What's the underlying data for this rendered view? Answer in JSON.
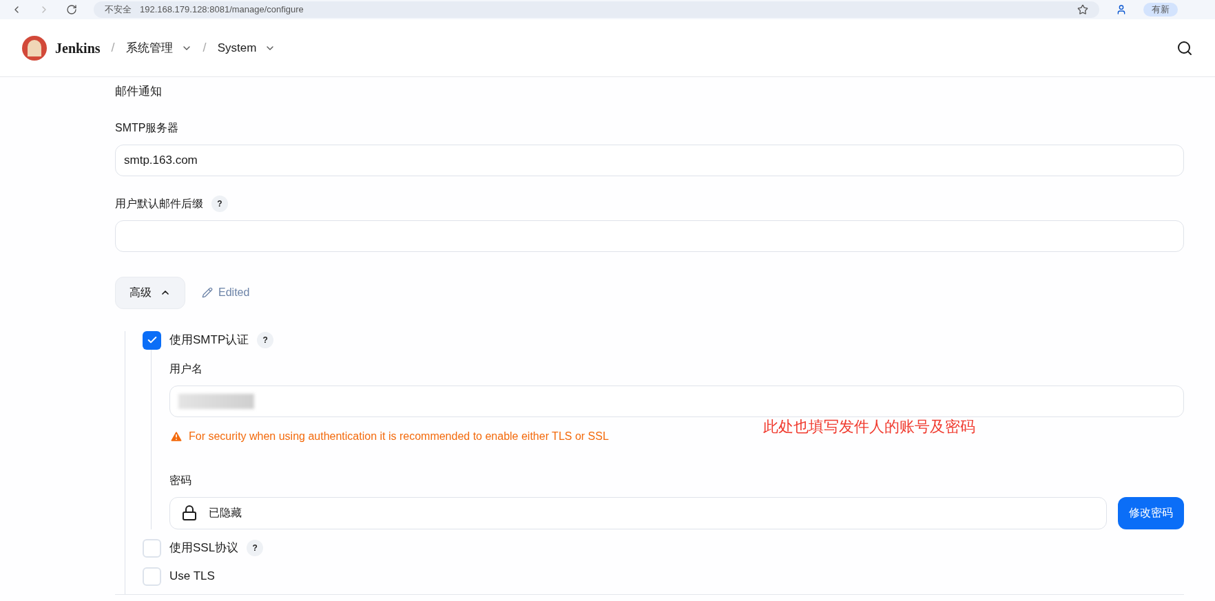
{
  "browser": {
    "security": "不安全",
    "url": "192.168.179.128:8081/manage/configure",
    "update_button": "有新"
  },
  "header": {
    "brand": "Jenkins",
    "breadcrumbs": [
      {
        "separator": "/",
        "label": "系统管理"
      },
      {
        "separator": "/",
        "label": "System"
      }
    ]
  },
  "section": {
    "title": "邮件通知"
  },
  "fields": [
    {
      "label": "SMTP服务器",
      "value": "smtp.163.com"
    },
    {
      "label": "用户默认邮件后缀",
      "help": "?"
    }
  ],
  "advanced": {
    "label": "高级",
    "expanded": true,
    "edited": "Edited"
  },
  "smtp_auth": {
    "label": "使用SMTP认证",
    "checked": true,
    "help": "?",
    "username": {
      "label": "用户名",
      "redacted": true,
      "warning": "For security when using authentication it is recommended to enable either TLS or SSL"
    },
    "password": {
      "label": "密码",
      "value": "已隐藏",
      "button": "修改密码"
    }
  },
  "options": [
    {
      "label": "使用SSL协议",
      "checked": false,
      "help": "?"
    },
    {
      "label": "Use TLS",
      "checked": false
    }
  ],
  "annotation": "此处也填写发件人的账号及密码"
}
